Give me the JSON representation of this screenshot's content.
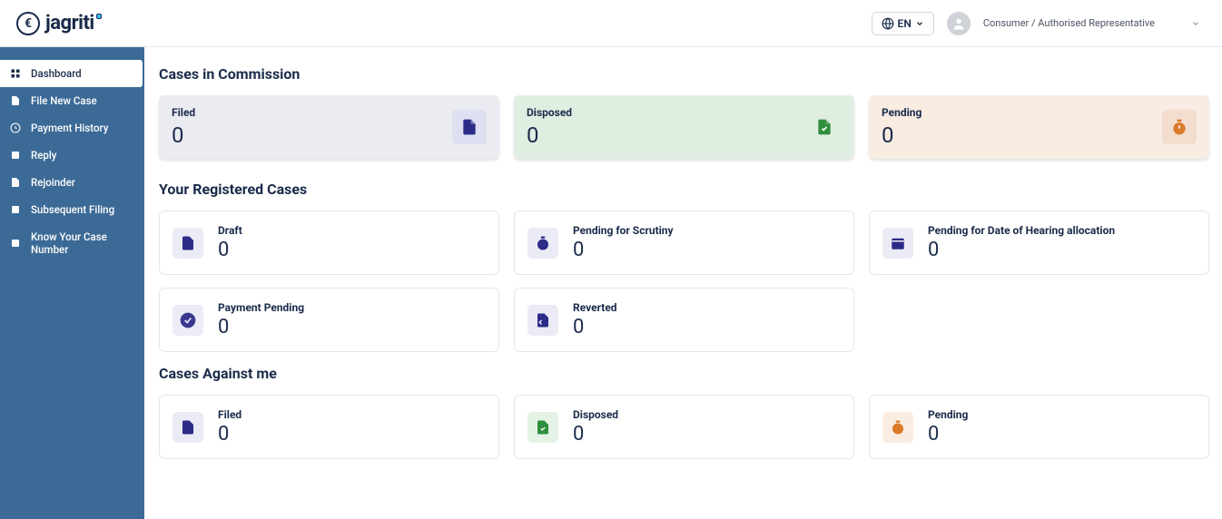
{
  "brand": "jagriti",
  "header": {
    "language_label": "EN",
    "role_label": "Consumer / Authorised Representative"
  },
  "sidebar": {
    "items": [
      {
        "label": "Dashboard"
      },
      {
        "label": "File New Case"
      },
      {
        "label": "Payment History"
      },
      {
        "label": "Reply"
      },
      {
        "label": "Rejoinder"
      },
      {
        "label": "Subsequent Filing"
      },
      {
        "label": "Know Your Case Number"
      }
    ]
  },
  "sections": {
    "commission_title": "Cases in Commission",
    "registered_title": "Your Registered Cases",
    "against_title": "Cases Against me"
  },
  "commission": {
    "filed": {
      "label": "Filed",
      "value": "0"
    },
    "disposed": {
      "label": "Disposed",
      "value": "0"
    },
    "pending": {
      "label": "Pending",
      "value": "0"
    }
  },
  "registered": {
    "draft": {
      "label": "Draft",
      "value": "0"
    },
    "scrutiny": {
      "label": "Pending for Scrutiny",
      "value": "0"
    },
    "hearing": {
      "label": "Pending for Date of Hearing allocation",
      "value": "0"
    },
    "payment_pending": {
      "label": "Payment Pending",
      "value": "0"
    },
    "reverted": {
      "label": "Reverted",
      "value": "0"
    }
  },
  "against": {
    "filed": {
      "label": "Filed",
      "value": "0"
    },
    "disposed": {
      "label": "Disposed",
      "value": "0"
    },
    "pending": {
      "label": "Pending",
      "value": "0"
    }
  }
}
